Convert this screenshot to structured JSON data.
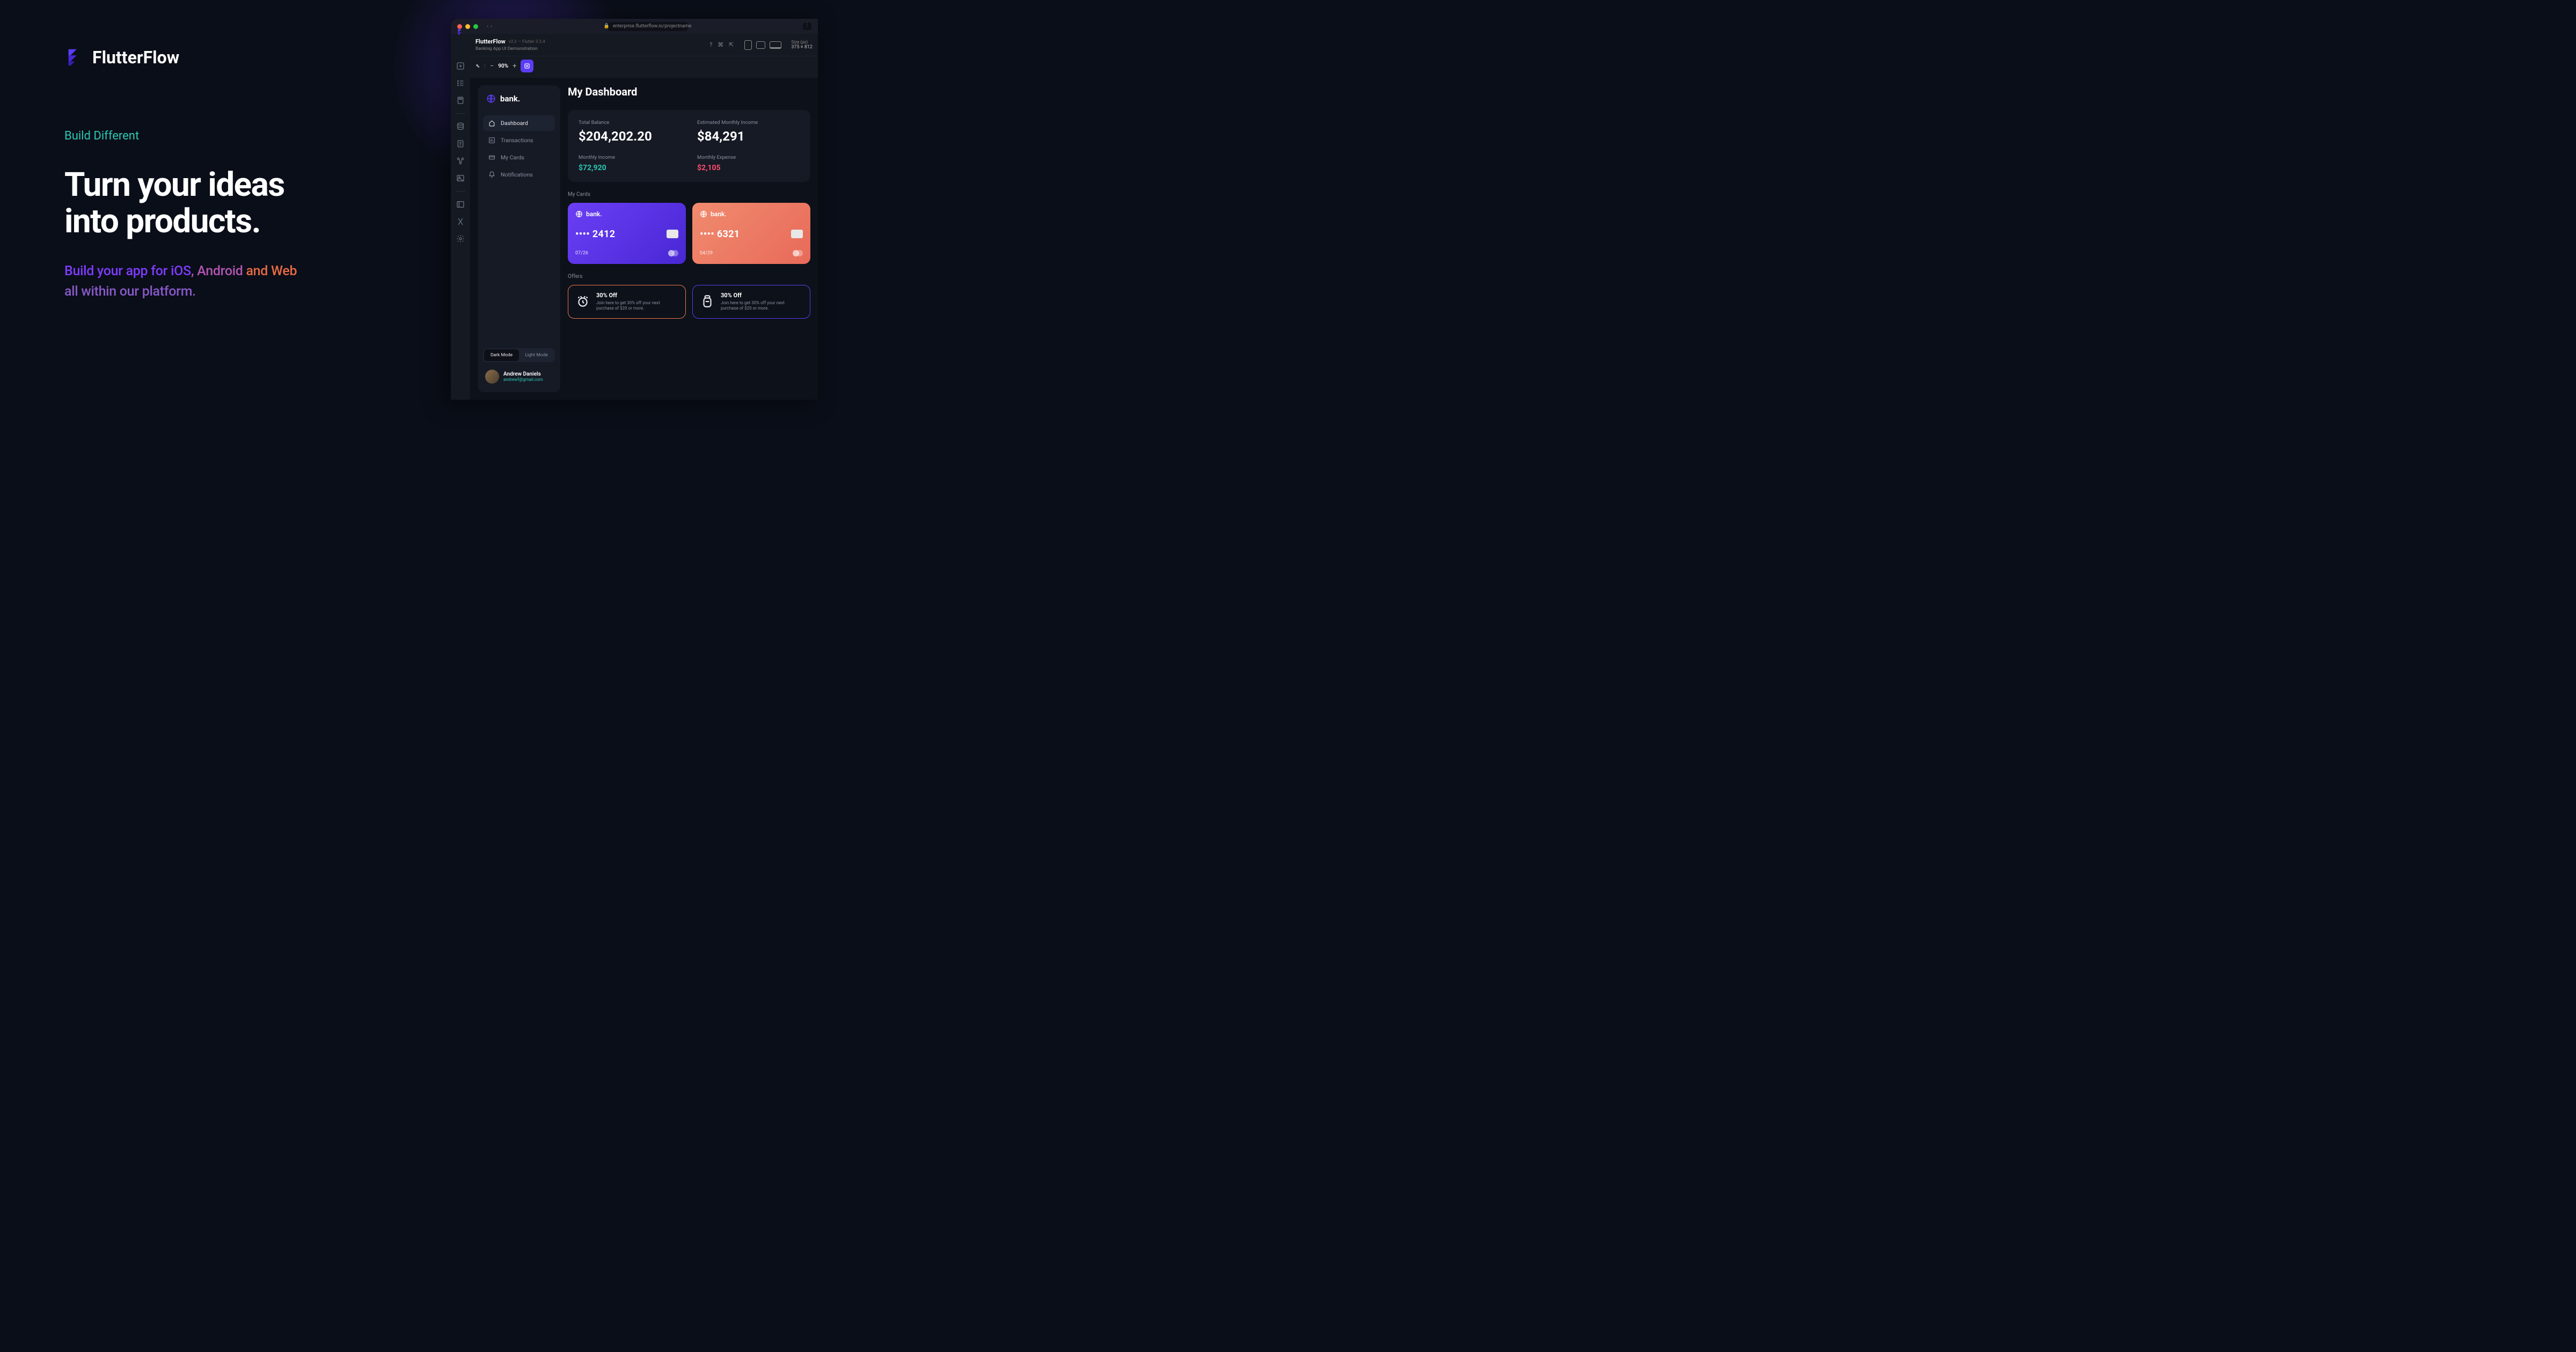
{
  "hero": {
    "brand": "FlutterFlow",
    "tagline": "Build Different",
    "headline_1": "Turn your ideas",
    "headline_2": "into products.",
    "subtitle_pre": "Build your app for ",
    "subtitle_ios": "iOS",
    "subtitle_sep1": ", ",
    "subtitle_android": "Android",
    "subtitle_sep2": " and ",
    "subtitle_web": "Web",
    "subtitle_line2": "all within our platform."
  },
  "browser": {
    "url": "enterprise.flutterflow.io/projectname"
  },
  "app_header": {
    "title": "FlutterFlow",
    "version": "v3.2 — Flutter 3.3.4",
    "subtitle": "Banking App UI Demonstration",
    "size_label": "Size (px)",
    "size_value": "375 × 812"
  },
  "toolbar": {
    "zoom": "90%"
  },
  "sidebar": {
    "brand": "bank.",
    "nav": [
      {
        "label": "Dashboard",
        "icon": "home"
      },
      {
        "label": "Transactions",
        "icon": "chart"
      },
      {
        "label": "My Cards",
        "icon": "card"
      },
      {
        "label": "Notifications",
        "icon": "bell"
      }
    ],
    "modes": {
      "dark": "Dark Mode",
      "light": "Light Mode"
    },
    "user": {
      "name": "Andrew Daniels",
      "email": "andrewf@gmail.com"
    }
  },
  "dashboard": {
    "title": "My Dashboard",
    "stats": {
      "total_label": "Total Balance",
      "total_value": "$204,202.20",
      "est_label": "Estimated Monthly Income",
      "est_value": "$84,291",
      "inc_label": "Monthly Income",
      "inc_value": "$72,920",
      "exp_label": "Monthly Expense",
      "exp_value": "$2,105"
    },
    "cards_label": "My Cards",
    "cards": [
      {
        "brand": "bank.",
        "digits": "•••• 2412",
        "exp": "07/26"
      },
      {
        "brand": "bank.",
        "digits": "•••• 6321",
        "exp": "04/29"
      }
    ],
    "offers_label": "Offers",
    "offers": [
      {
        "title": "30% Off",
        "desc": "Join here to get 30% off your next purchase of $20 or more."
      },
      {
        "title": "30% Off",
        "desc": "Join here to get 30% off your next purchase of $20 or more."
      }
    ]
  }
}
